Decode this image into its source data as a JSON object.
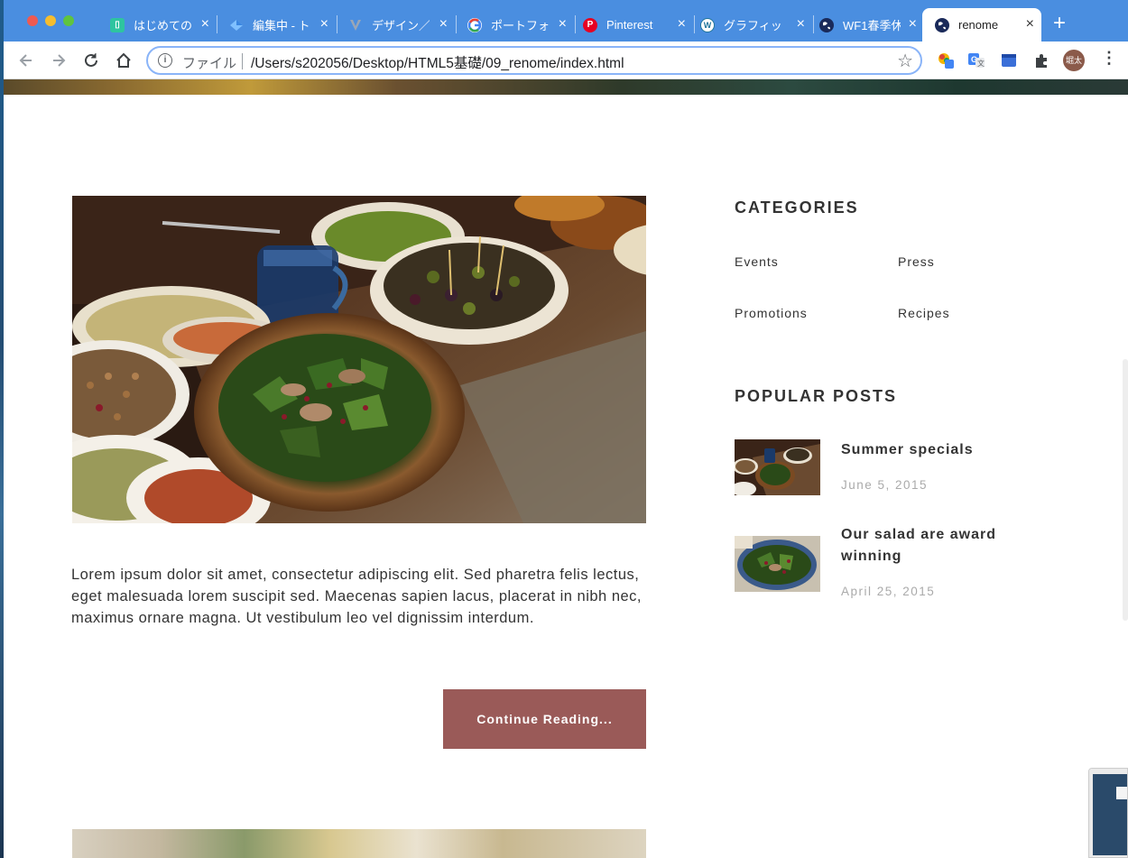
{
  "browser": {
    "tabs": [
      {
        "label": "はじめての",
        "icon": "notebook-icon",
        "color": "#2ec4a0"
      },
      {
        "label": "編集中 - ト",
        "icon": "diamond-icon",
        "color": "#5aa0f0"
      },
      {
        "label": "デザイン／",
        "icon": "v-logo-icon",
        "color": "#9aa6b6"
      },
      {
        "label": "ポートフォ",
        "icon": "google-icon",
        "color": "#ffffff"
      },
      {
        "label": "Pinterest",
        "icon": "pinterest-icon",
        "color": "#e60023"
      },
      {
        "label": "グラフィッ",
        "icon": "wordpress-icon",
        "color": "#21759b"
      },
      {
        "label": "WF1春季休",
        "icon": "globe-icon",
        "color": "#1a2a5a"
      },
      {
        "label": "renome",
        "icon": "globe-icon",
        "color": "#1a2a5a",
        "active": true
      }
    ],
    "address_scheme": "ファイル",
    "address_url": "/Users/s202056/Desktop/HTML5基礎/09_renome/index.html",
    "profile_initials": "堀太"
  },
  "post": {
    "body": "Lorem ipsum dolor sit amet, consectetur adipiscing elit. Sed pharetra felis lectus, eget malesuada lorem suscipit sed. Maecenas sapien lacus, placerat in nibh nec, maximus ornare magna. Ut vestibulum leo vel dignissim interdum.",
    "continue_label": "Continue Reading..."
  },
  "sidebar": {
    "categories_heading": "CATEGORIES",
    "categories": [
      "Events",
      "Press",
      "Promotions",
      "Recipes"
    ],
    "popular_heading": "POPULAR POSTS",
    "popular_posts": [
      {
        "title": "Summer specials",
        "date": "June 5, 2015"
      },
      {
        "title": "Our salad are award winning",
        "date": "April 25, 2015"
      }
    ]
  },
  "colors": {
    "accent_button": "#9a5a58",
    "tab_strip": "#4a8ee0",
    "heading_text": "#333333",
    "date_text": "#aaaaaa"
  }
}
